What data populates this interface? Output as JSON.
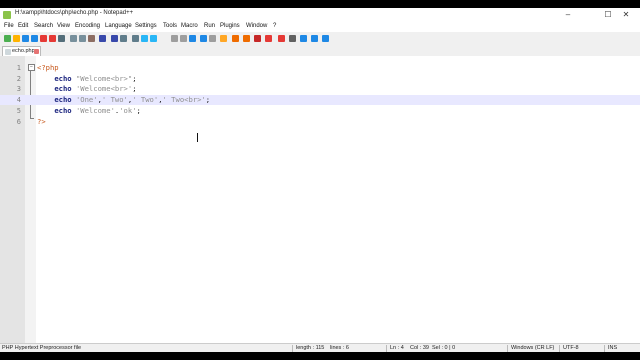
{
  "window": {
    "title": "H:\\xampp\\htdocs\\php\\echo.php - Notepad++",
    "controls": {
      "minimize": "–",
      "maximize": "☐",
      "close": "✕"
    }
  },
  "menu": [
    "File",
    "Edit",
    "Search",
    "View",
    "Encoding",
    "Language",
    "Settings",
    "Tools",
    "Macro",
    "Run",
    "Plugins",
    "Window",
    "?"
  ],
  "toolbar_icons": [
    "new-file-icon",
    "open-file-icon",
    "save-icon",
    "save-all-icon",
    "close-icon",
    "close-all-icon",
    "print-icon",
    "cut-icon",
    "copy-icon",
    "paste-icon",
    "undo-icon",
    "redo-icon",
    "find-icon",
    "replace-icon",
    "zoom-in-icon",
    "zoom-out-icon",
    "sync-scroll-v-icon",
    "sync-scroll-h-icon",
    "word-wrap-icon",
    "show-all-chars-icon",
    "indent-guide-icon",
    "udl-icon",
    "doc-map-icon",
    "function-list-icon",
    "folder-workspace-icon",
    "monitoring-icon",
    "record-macro-icon",
    "stop-macro-icon",
    "play-macro-icon",
    "run-macro-icon",
    "save-macro-icon"
  ],
  "tab": {
    "label": "echo.php"
  },
  "editor": {
    "current_line": 4,
    "lines": [
      {
        "no": "1",
        "fold": "⊟",
        "tokens": [
          {
            "t": "<?php",
            "c": "php"
          }
        ]
      },
      {
        "no": "2",
        "tokens": [
          {
            "t": "    ",
            "c": "op"
          },
          {
            "t": "echo",
            "c": "kw"
          },
          {
            "t": " ",
            "c": "op"
          },
          {
            "t": "\"Welcome<br>\"",
            "c": "str"
          },
          {
            "t": ";",
            "c": "op"
          }
        ]
      },
      {
        "no": "3",
        "tokens": [
          {
            "t": "    ",
            "c": "op"
          },
          {
            "t": "echo",
            "c": "kw"
          },
          {
            "t": " ",
            "c": "op"
          },
          {
            "t": "'Welcome<br>'",
            "c": "str"
          },
          {
            "t": ";",
            "c": "op"
          }
        ]
      },
      {
        "no": "4",
        "tokens": [
          {
            "t": "    ",
            "c": "op"
          },
          {
            "t": "echo",
            "c": "kw"
          },
          {
            "t": " ",
            "c": "op"
          },
          {
            "t": "'One'",
            "c": "str"
          },
          {
            "t": ",",
            "c": "op"
          },
          {
            "t": "' Two'",
            "c": "str"
          },
          {
            "t": ",",
            "c": "op"
          },
          {
            "t": "' Two'",
            "c": "str"
          },
          {
            "t": ",",
            "c": "op"
          },
          {
            "t": "' Two<br>'",
            "c": "str"
          },
          {
            "t": ";",
            "c": "op"
          }
        ]
      },
      {
        "no": "5",
        "tokens": [
          {
            "t": "    ",
            "c": "op"
          },
          {
            "t": "echo",
            "c": "kw"
          },
          {
            "t": " ",
            "c": "op"
          },
          {
            "t": "'Welcome'",
            "c": "str"
          },
          {
            "t": ".",
            "c": "op"
          },
          {
            "t": "'ok'",
            "c": "str"
          },
          {
            "t": ";",
            "c": "op"
          }
        ]
      },
      {
        "no": "6",
        "tokens": [
          {
            "t": "?>",
            "c": "php"
          }
        ]
      }
    ]
  },
  "status": {
    "file_type": "PHP Hypertext Preprocessor file",
    "length": "length : 115",
    "lines": "lines : 6",
    "ln": "Ln : 4",
    "col": "Col : 39",
    "sel": "Sel : 0 | 0",
    "eol": "Windows (CR LF)",
    "encoding": "UTF-8",
    "mode": "INS"
  }
}
